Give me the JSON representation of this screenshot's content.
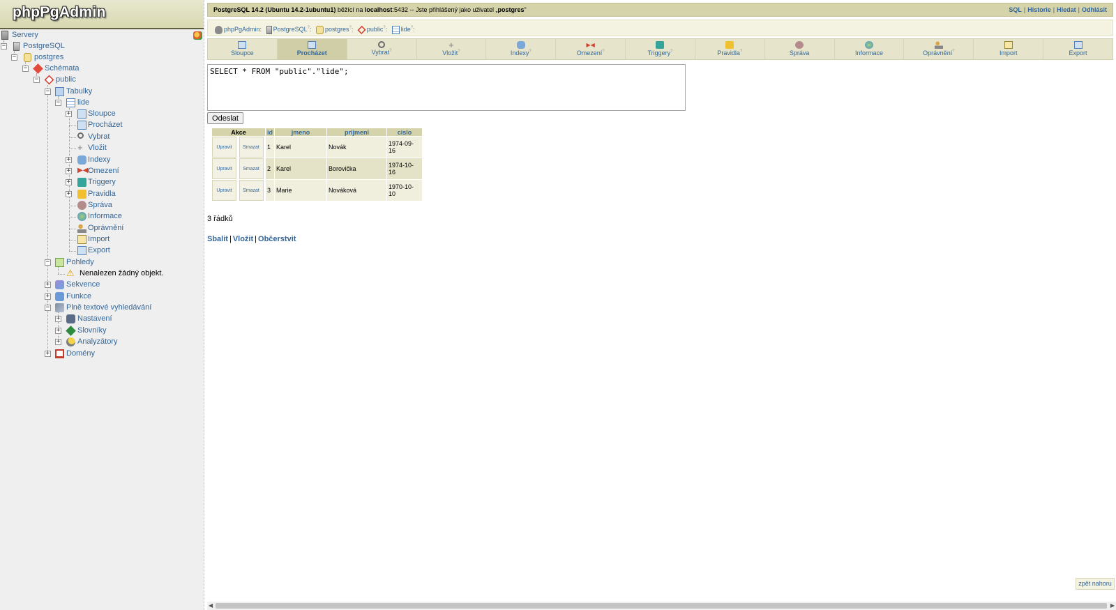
{
  "logo": {
    "text": "phpPgAdmin"
  },
  "tree": {
    "servers": "Servery",
    "server": "PostgreSQL",
    "database": "postgres",
    "schemas": "Schémata",
    "schema": "public",
    "tables": "Tabulky",
    "table": "lide",
    "table_children": [
      "Sloupce",
      "Procházet",
      "Vybrat",
      "Vložit",
      "Indexy",
      "Omezení",
      "Triggery",
      "Pravidla",
      "Správa",
      "Informace",
      "Oprávnění",
      "Import",
      "Export"
    ],
    "views": "Pohledy",
    "no_objects": "Nenalezen žádný objekt.",
    "sequences": "Sekvence",
    "functions": "Funkce",
    "fulltext": "Plně textové vyhledávání",
    "fulltext_children": [
      "Nastavení",
      "Slovníky",
      "Analyzátory"
    ],
    "domains": "Domény"
  },
  "topbar": {
    "server_version": "PostgreSQL 14.2 (Ubuntu 14.2-1ubuntu1)",
    "running_on": "běžící na",
    "host": "localhost",
    "port_text": ":5432 -- Jste přihlášený jako uživatel „",
    "user": "postgres",
    "close_quote": "\"",
    "links": {
      "sql": "SQL",
      "history": "Historie",
      "find": "Hledat",
      "logout": "Odhlásit"
    }
  },
  "trail": [
    "phpPgAdmin:",
    "PostgreSQL",
    "postgres",
    "public",
    "lide"
  ],
  "tabs": [
    {
      "label": "Sloupce",
      "help": false
    },
    {
      "label": "Procházet",
      "help": false,
      "active": true
    },
    {
      "label": "Vybrat",
      "help": true
    },
    {
      "label": "Vložit",
      "help": true
    },
    {
      "label": "Indexy",
      "help": true
    },
    {
      "label": "Omezení",
      "help": true
    },
    {
      "label": "Triggery",
      "help": true
    },
    {
      "label": "Pravidla",
      "help": true
    },
    {
      "label": "Správa",
      "help": false
    },
    {
      "label": "Informace",
      "help": false
    },
    {
      "label": "Oprávnění",
      "help": true
    },
    {
      "label": "Import",
      "help": false
    },
    {
      "label": "Export",
      "help": false
    }
  ],
  "query": {
    "text": "SELECT * FROM \"public\".\"lide\";",
    "submit": "Odeslat"
  },
  "result": {
    "headers": {
      "actions": "Akce",
      "columns": [
        "id",
        "jmeno",
        "prijmeni",
        "cislo"
      ]
    },
    "actions": {
      "edit": "Upravit",
      "delete": "Smazat"
    },
    "rows": [
      [
        "1",
        "Karel",
        "Novák",
        "1974-09-16"
      ],
      [
        "2",
        "Karel",
        "Borovička",
        "1974-10-16"
      ],
      [
        "3",
        "Marie",
        "Nováková",
        "1970-10-10"
      ]
    ]
  },
  "row_count": "3 řádků",
  "bottom_links": {
    "collapse": "Sbalit",
    "insert": "Vložit",
    "refresh": "Občerstvit"
  },
  "back_to_top": "zpět nahoru",
  "help_mark": "?",
  "colors": {
    "header": "#d4d3aa",
    "link": "#336699",
    "left_bg": "#efefef"
  }
}
